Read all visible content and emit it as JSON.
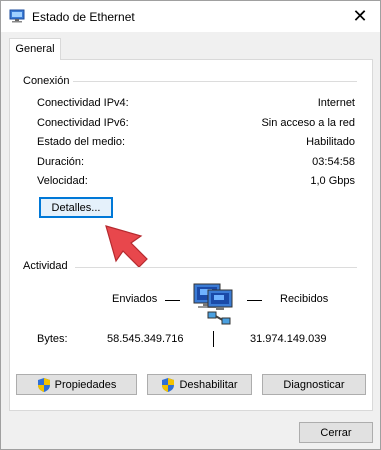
{
  "window": {
    "title": "Estado de Ethernet"
  },
  "tabs": [
    {
      "label": "General"
    }
  ],
  "connection": {
    "heading": "Conexión",
    "rows": [
      {
        "label": "Conectividad IPv4:",
        "value": "Internet"
      },
      {
        "label": "Conectividad IPv6:",
        "value": "Sin acceso a la red"
      },
      {
        "label": "Estado del medio:",
        "value": "Habilitado"
      },
      {
        "label": "Duración:",
        "value": "03:54:58"
      },
      {
        "label": "Velocidad:",
        "value": "1,0 Gbps"
      }
    ],
    "details_button": "Detalles..."
  },
  "activity": {
    "heading": "Actividad",
    "sent_label": "Enviados",
    "received_label": "Recibidos",
    "bytes_label": "Bytes:",
    "bytes_sent": "58.545.349.716",
    "bytes_received": "31.974.149.039"
  },
  "buttons": {
    "properties": "Propiedades",
    "disable": "Deshabilitar",
    "diagnose": "Diagnosticar",
    "close": "Cerrar"
  },
  "colors": {
    "accent": "#0078d7",
    "arrow": "#e8474c"
  }
}
